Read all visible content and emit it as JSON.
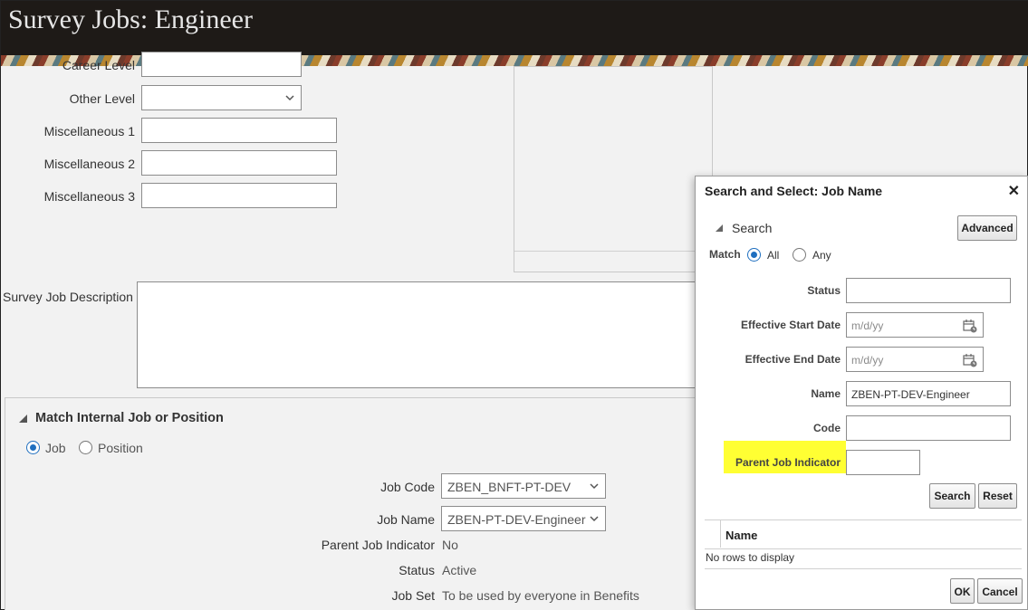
{
  "header": {
    "title": "Survey Jobs: Engineer"
  },
  "form": {
    "career_level_label": "Career Level",
    "other_level_label": "Other Level",
    "misc1_label": "Miscellaneous 1",
    "misc2_label": "Miscellaneous 2",
    "misc3_label": "Miscellaneous 3",
    "description_label": "Survey Job Description"
  },
  "match_section": {
    "title": "Match Internal Job or Position",
    "options": [
      "Job",
      "Position"
    ],
    "selected": "Job",
    "job_code_label": "Job Code",
    "job_code_value": "ZBEN_BNFT-PT-DEV",
    "job_name_label": "Job Name",
    "job_name_value": "ZBEN-PT-DEV-Engineer",
    "parent_job_indicator_label": "Parent Job Indicator",
    "parent_job_indicator_value": "No",
    "status_label": "Status",
    "status_value": "Active",
    "job_set_label": "Job Set",
    "job_set_value": "To be used by everyone in Benefits"
  },
  "dialog": {
    "title": "Search and Select: Job Name",
    "search_label": "Search",
    "advanced_button": "Advanced",
    "match_label": "Match",
    "match_all": "All",
    "match_any": "Any",
    "match_selected": "All",
    "fields": {
      "status_label": "Status",
      "status_value": "",
      "eff_start_label": "Effective Start Date",
      "eff_start_placeholder": "m/d/yy",
      "eff_end_label": "Effective End Date",
      "eff_end_placeholder": "m/d/yy",
      "name_label": "Name",
      "name_value": "ZBEN-PT-DEV-Engineer",
      "code_label": "Code",
      "code_value": "",
      "parent_job_indicator_label": "Parent Job Indicator",
      "parent_job_indicator_value": ""
    },
    "search_button": "Search",
    "reset_button": "Reset",
    "results_column": "Name",
    "no_rows": "No rows to display",
    "ok_button": "OK",
    "cancel_button": "Cancel",
    "highlight_color": "#ffff33"
  }
}
